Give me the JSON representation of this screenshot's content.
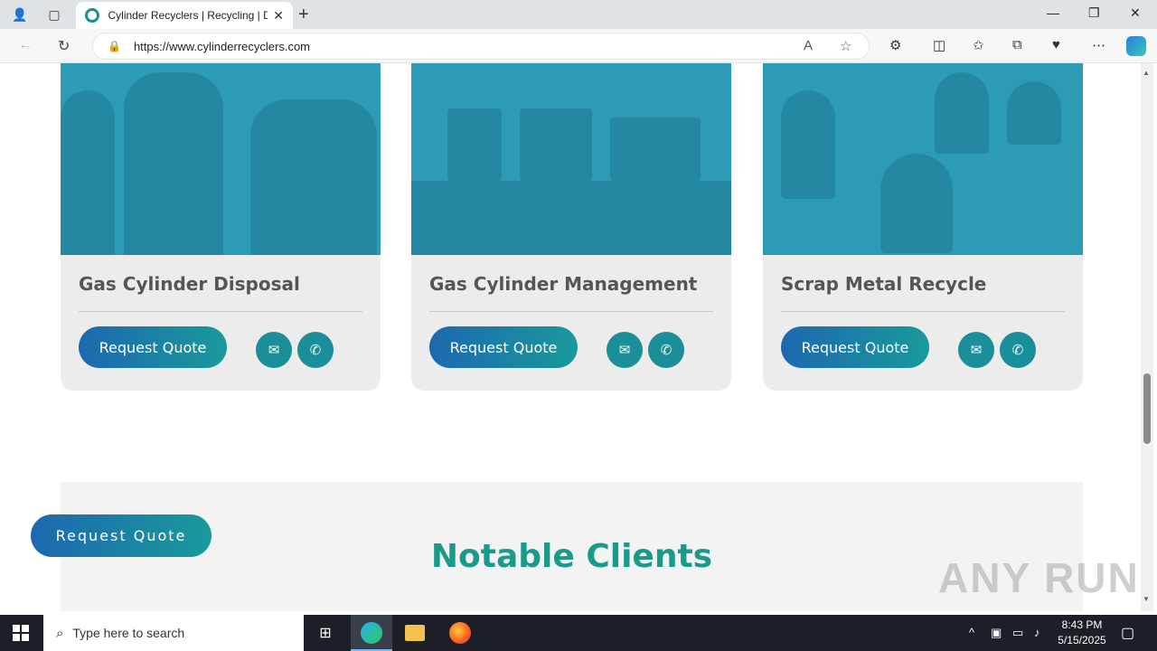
{
  "browser": {
    "tab_title": "Cylinder Recyclers | Recycling | D",
    "url": "https://www.cylinderrecyclers.com"
  },
  "services": [
    {
      "title": "Gas Cylinder Disposal",
      "button": "Request Quote",
      "photo": "gas cylinders close-up"
    },
    {
      "title": "Gas Cylinder Management",
      "button": "Request Quote",
      "photo": "cylinder storage yard"
    },
    {
      "title": "Scrap Metal Recycle",
      "button": "Request Quote",
      "photo": "propane tanks in yard"
    }
  ],
  "clients": {
    "title": "Notable Clients"
  },
  "floating_button": {
    "label": "Request Quote"
  },
  "watermark": "ANY RUN",
  "taskbar": {
    "search_placeholder": "Type here to search",
    "time": "8:43 PM",
    "date": "5/15/2025"
  },
  "colors": {
    "accent_teal": "#1a9a8a",
    "button_blue": "#1c68b0",
    "card_bg": "#ececec"
  }
}
